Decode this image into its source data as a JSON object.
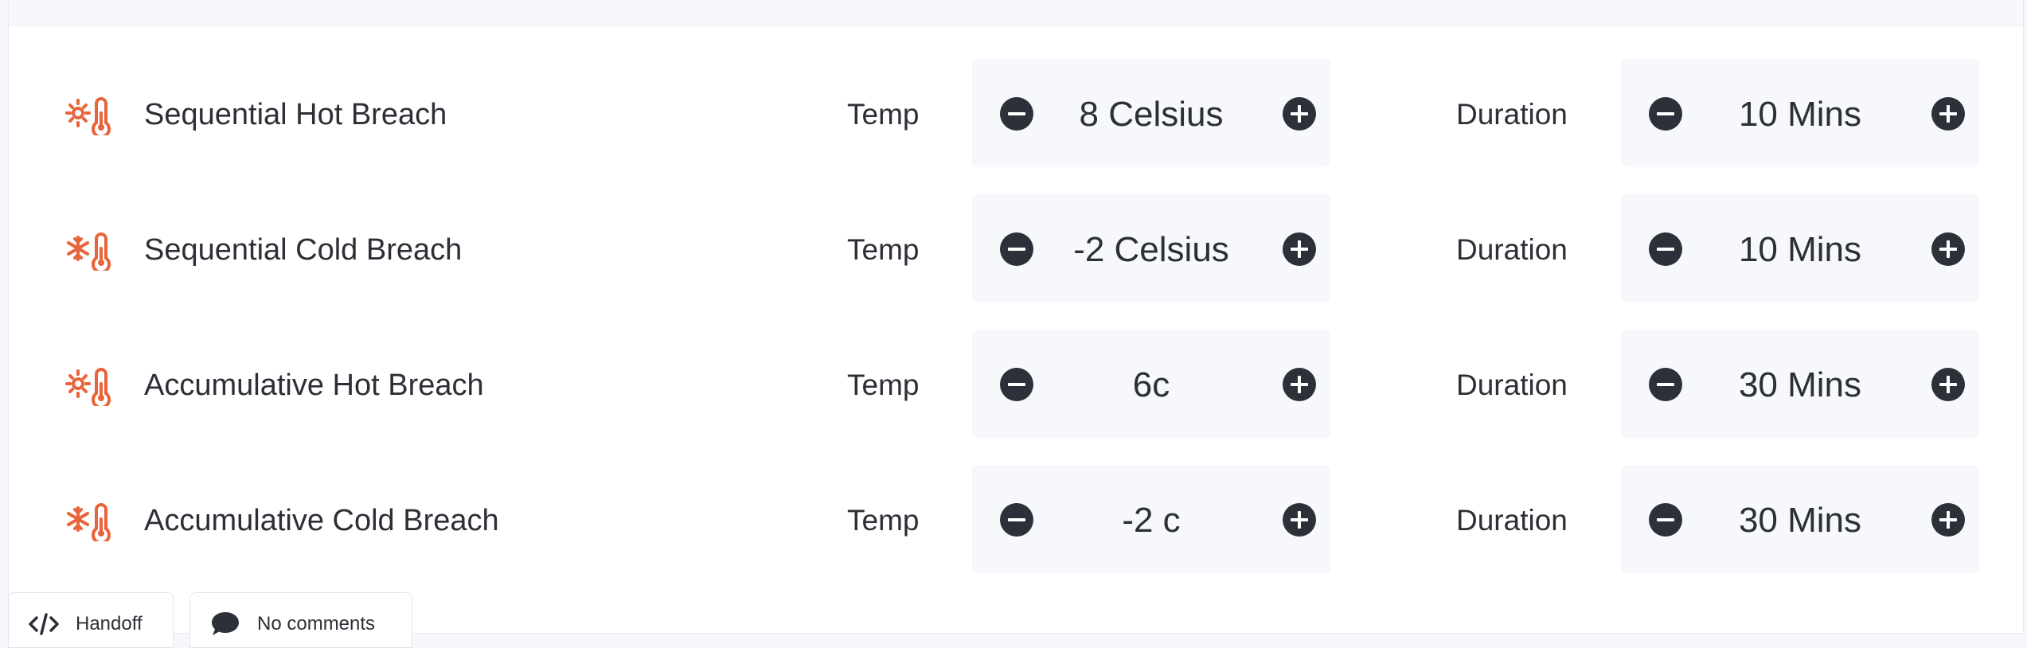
{
  "colors": {
    "accent_icon": "#e8643a",
    "stepper_button": "#2c3139",
    "stepper_background": "#f6f8fc"
  },
  "breaches": [
    {
      "name": "Sequential Hot Breach",
      "icon": "hot-thermometer-icon",
      "temp_label": "Temp",
      "temp_value": "8 Celsius",
      "duration_label": "Duration",
      "duration_value": "10 Mins"
    },
    {
      "name": "Sequential Cold Breach",
      "icon": "cold-thermometer-icon",
      "temp_label": "Temp",
      "temp_value": "-2 Celsius",
      "duration_label": "Duration",
      "duration_value": "10 Mins"
    },
    {
      "name": "Accumulative Hot Breach",
      "icon": "hot-thermometer-icon",
      "temp_label": "Temp",
      "temp_value": "6c",
      "duration_label": "Duration",
      "duration_value": "30 Mins"
    },
    {
      "name": "Accumulative Cold Breach",
      "icon": "cold-thermometer-icon",
      "temp_label": "Temp",
      "temp_value": "-2 c",
      "duration_label": "Duration",
      "duration_value": "30 Mins"
    }
  ],
  "footer_tabs": {
    "handoff": {
      "label": "Handoff",
      "icon": "code-icon"
    },
    "comments": {
      "label": "No comments",
      "icon": "comment-bubble-icon"
    }
  }
}
